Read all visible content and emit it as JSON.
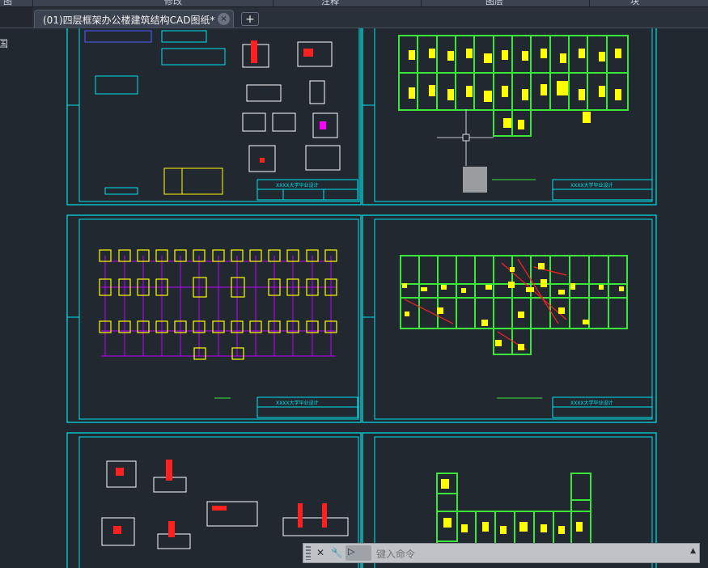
{
  "ribbon": {
    "sections": [
      "图",
      "修改",
      "注释",
      "图层",
      "块"
    ]
  },
  "tab": {
    "title": "(01)四层框架办公楼建筑结构CAD图纸*",
    "close_glyph": "×",
    "new_glyph": "+"
  },
  "left_label": "国",
  "command": {
    "placeholder": "键入命令",
    "close_glyph": "✕",
    "tool_glyph": "🔧",
    "prompt_glyph": "▷",
    "dropdown_glyph": "▲"
  },
  "title_block_text": "XXXX大学毕业设计",
  "colors": {
    "background": "#212830",
    "frame": "#00e5ef",
    "beam": "#39e639",
    "column": "#ffff00",
    "axis": "#c000ff",
    "rebar": "#ff2020"
  }
}
